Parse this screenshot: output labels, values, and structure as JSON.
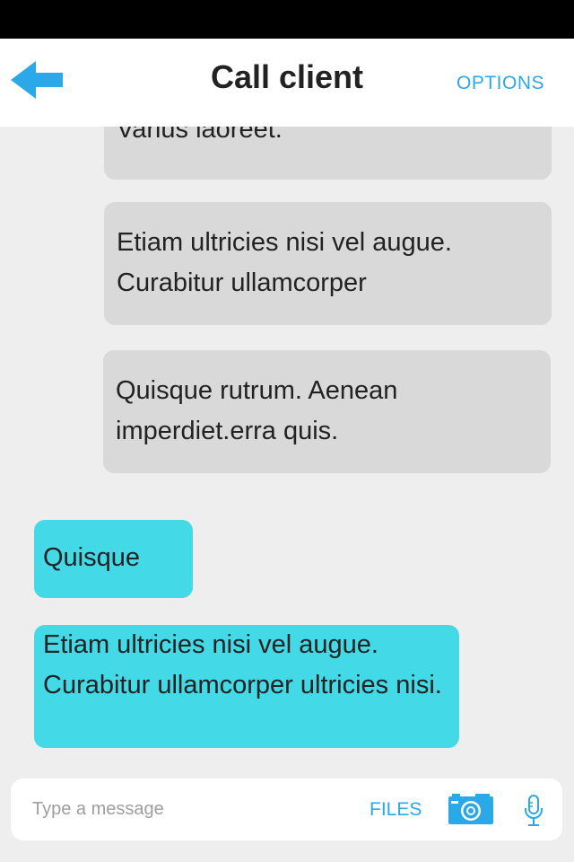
{
  "header": {
    "title": "Call client",
    "back_icon": "arrow-left-icon",
    "options_label": "OPTIONS"
  },
  "messages": [
    {
      "direction": "incoming",
      "text": "Varius laoreet."
    },
    {
      "direction": "incoming",
      "text": "Etiam ultricies nisi vel augue. Curabitur ullamcorper"
    },
    {
      "direction": "incoming",
      "text": "Quisque rutrum. Aenean imperdiet.erra quis."
    },
    {
      "direction": "outgoing",
      "text": "Quisque"
    },
    {
      "direction": "outgoing",
      "text": "Etiam ultricies nisi vel augue. Curabitur ullamcorper ultricies nisi."
    }
  ],
  "composer": {
    "placeholder": "Type a message",
    "value": "",
    "files_label": "FILES",
    "camera_icon": "camera-icon",
    "mic_icon": "microphone-icon"
  },
  "colors": {
    "accent": "#2aa8e8",
    "incoming_bubble": "#d9d9d9",
    "outgoing_bubble": "#44d9e6",
    "background": "#eeeeee",
    "status_bar": "#000000"
  }
}
